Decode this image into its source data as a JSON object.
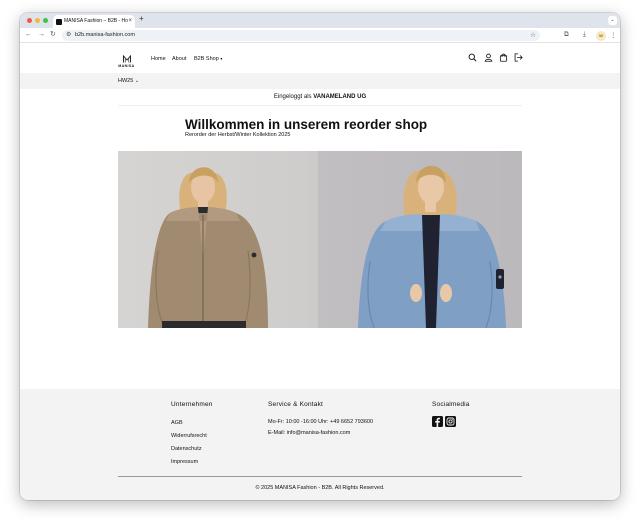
{
  "browser": {
    "tab_title": "MANISA Fashion – B2B - Ho",
    "tab_close": "×",
    "new_tab": "+",
    "url": "b2b.manisa-fashion.com",
    "profile_initial": "W"
  },
  "site": {
    "logo_text": "MANISA",
    "nav": [
      "Home",
      "About",
      "B2B Shop"
    ],
    "season": "HW25",
    "logged_in_prefix": "Eingeloggt als",
    "logged_in_user": "VANAMELAND UG",
    "welcome_title": "Willkommen in unserem reorder shop",
    "welcome_subtitle": "Rerorder der Herbst/Winter Kollektion 2025"
  },
  "footer": {
    "col1_title": "Unternehmen",
    "col1_links": [
      "AGB",
      "Widerrufsrecht",
      "Datenschutz",
      "Impressum"
    ],
    "col2_title": "Service & Kontakt",
    "phone": "Mo-Fr: 10:00 -16:00 Uhr: +49 6652 793600",
    "email": "E-Mail: info@manisa-fashion.com",
    "col3_title": "Socialmedia",
    "copyright": "© 2025 MANISA Fashion - B2B. All Rights Reserved."
  },
  "colors": {
    "jacket_left": "#a08a70",
    "jacket_right": "#7f9fc4",
    "footer_bg": "#f3f3f3"
  }
}
